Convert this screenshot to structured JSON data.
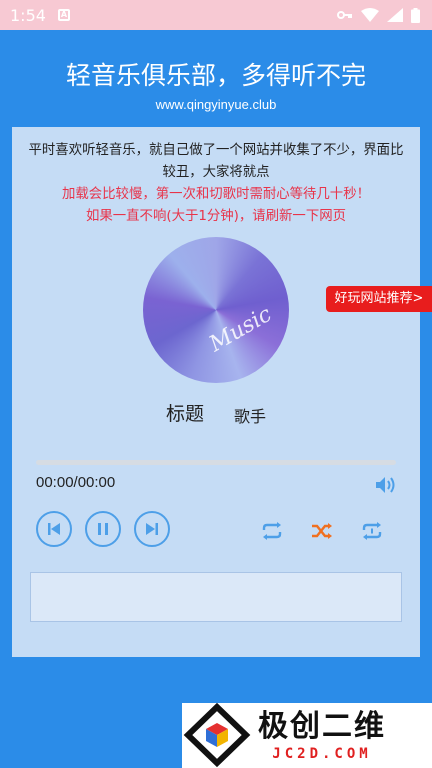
{
  "status_bar": {
    "time": "1:54",
    "notification_glyph": "A",
    "icons": [
      "vpn-key-icon",
      "wifi-icon",
      "signal-icon",
      "battery-icon"
    ]
  },
  "header": {
    "title": "轻音乐俱乐部，多得听不完",
    "url": "www.qingyinyue.club"
  },
  "intro": {
    "line1": "平时喜欢听轻音乐，就自己做了一个网站并收集了不少，界面比",
    "line2": "较丑，大家将就点",
    "warn1": "加载会比较慢，第一次和切歌时需耐心等待几十秒！",
    "warn2": "如果一直不响(大于1分钟)，请刷新一下网页"
  },
  "disc": {
    "label": "Music"
  },
  "song": {
    "title": "标题",
    "artist": "歌手"
  },
  "player": {
    "time_display": "00:00/00:00",
    "progress": 0,
    "controls": [
      "previous-icon",
      "pause-icon",
      "next-icon"
    ],
    "modes": [
      "repeat-all-icon",
      "shuffle-icon",
      "repeat-one-icon"
    ],
    "active_mode": "shuffle"
  },
  "promo": {
    "label": "好玩网站推荐>"
  },
  "watermark": {
    "cn": "极创二维",
    "en": "JC2D.COM"
  },
  "colors": {
    "background": "#2b8ce8",
    "status_bar": "#f7c9d3",
    "card": "#c5dcf5",
    "accent": "#4d9fe8",
    "warning_text": "#e8344a",
    "promo": "#e81d1d",
    "shuffle_active": "#f07020"
  }
}
